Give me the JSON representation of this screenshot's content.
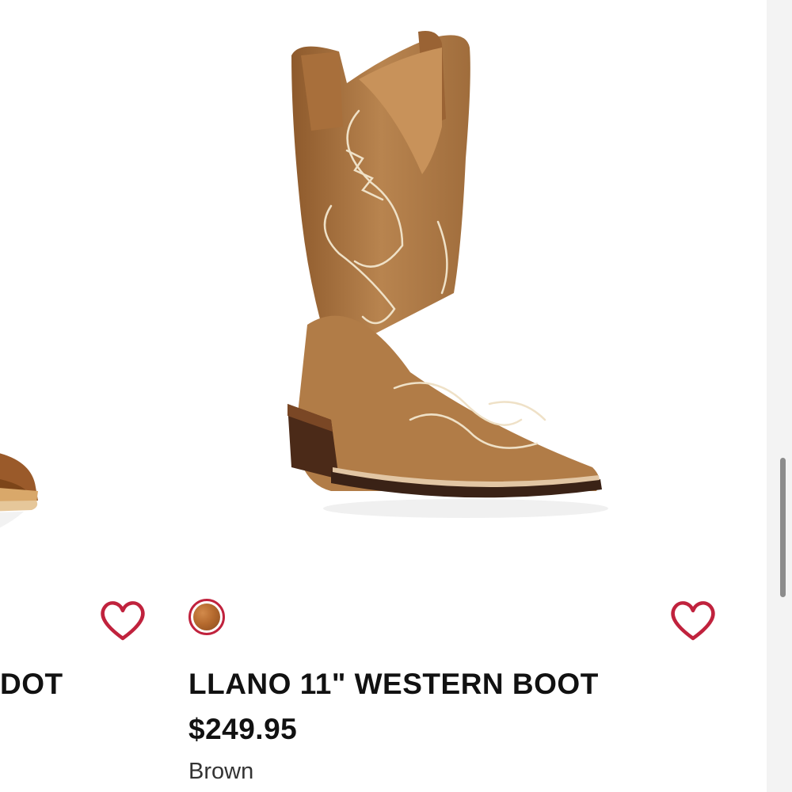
{
  "product_grid": {
    "left_card": {
      "title": "DOT",
      "favorite_icon": "heart-outline-icon"
    },
    "main_card": {
      "title": "LLANO 11\" WESTERN BOOT",
      "price": "$249.95",
      "color_name": "Brown",
      "favorite_icon": "heart-outline-icon",
      "swatch_icon": "color-swatch-brown"
    }
  },
  "colors": {
    "accent": "#c0223d",
    "boot_leather": "#b37a44",
    "scrollbar_thumb": "#8c8c8c"
  }
}
